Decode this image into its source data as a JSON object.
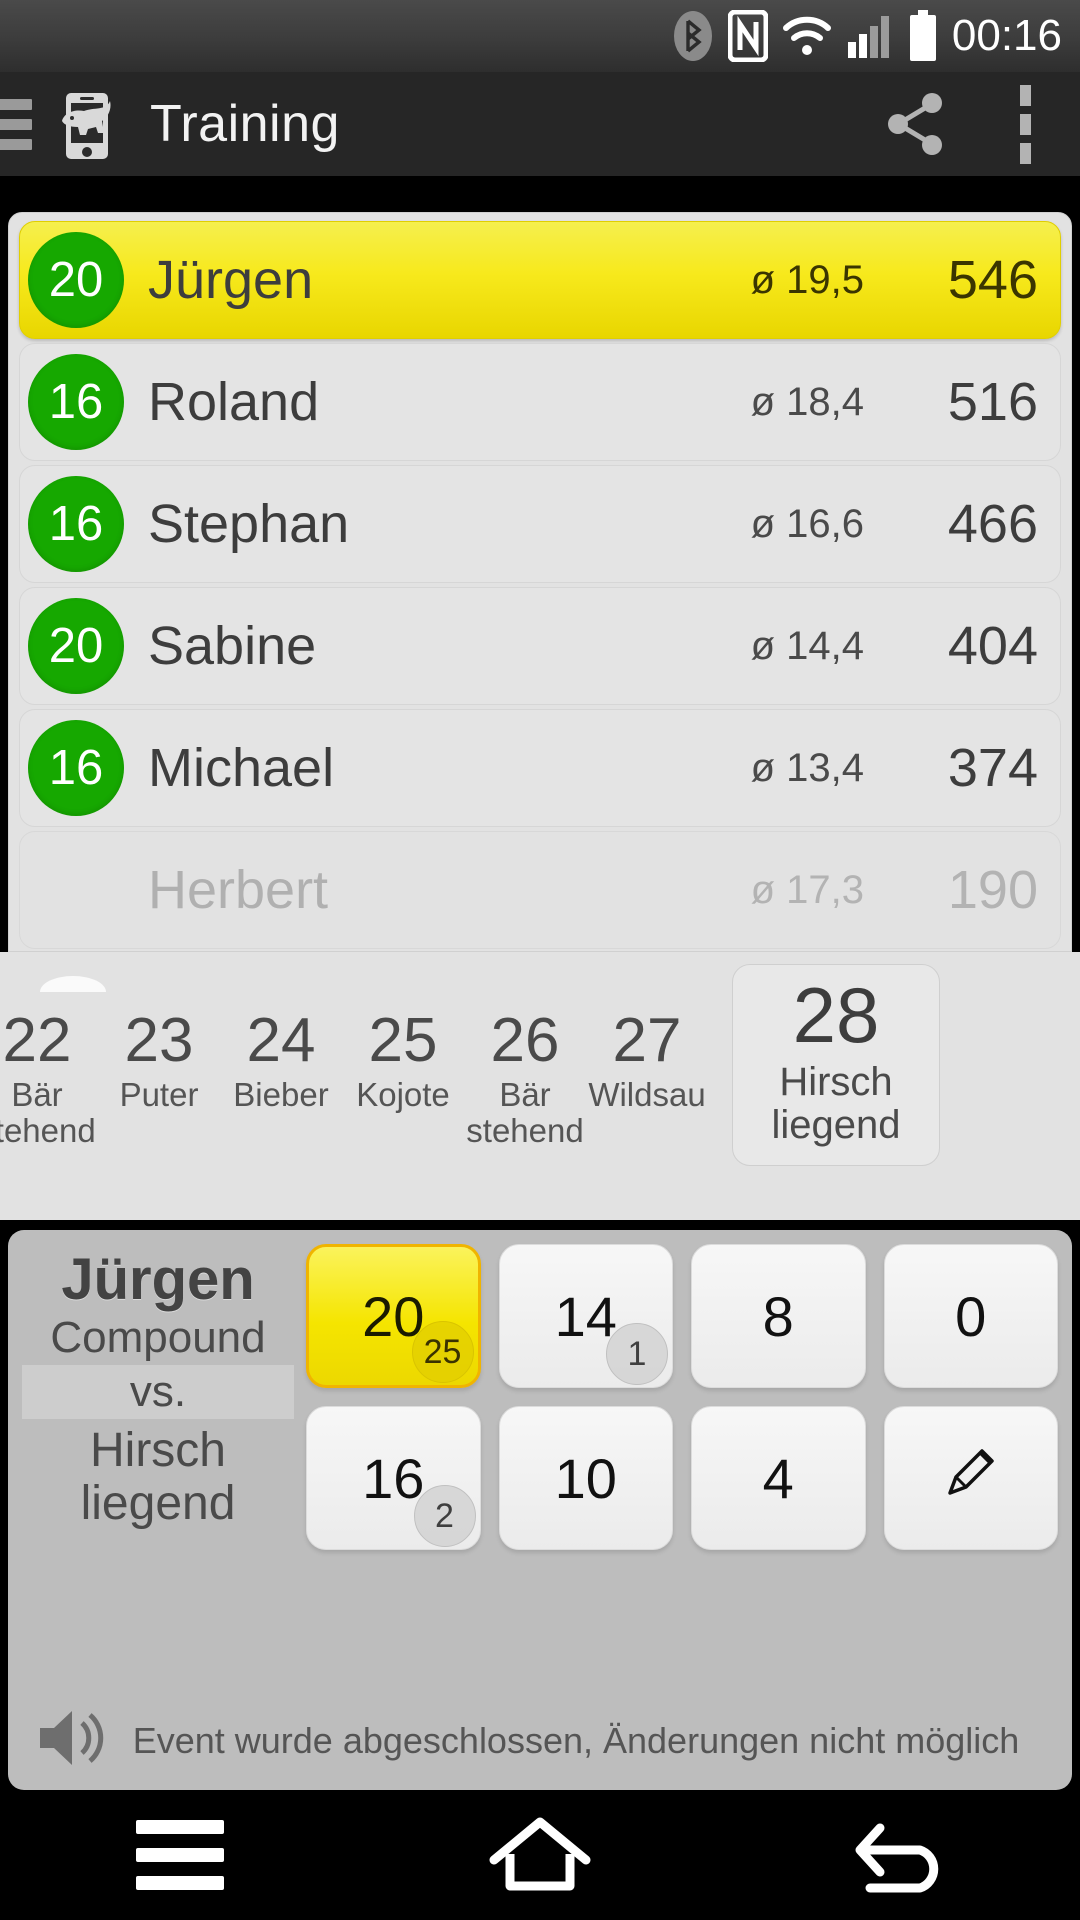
{
  "status_bar": {
    "clock": "00:16",
    "icons": [
      "bluetooth-icon",
      "nfc-icon",
      "wifi-icon",
      "cellular-signal-icon",
      "battery-icon"
    ]
  },
  "app_bar": {
    "title": "Training",
    "drawer_icon": "hamburger-menu-icon",
    "logo_icon": "boar-on-phone-app-icon",
    "share_icon": "share-icon",
    "overflow_icon": "overflow-menu-icon"
  },
  "leaderboard": {
    "rows": [
      {
        "badge": "20",
        "name": "Jürgen",
        "avg": "ø 19,5",
        "total": "546",
        "state": "leader"
      },
      {
        "badge": "16",
        "name": "Roland",
        "avg": "ø 18,4",
        "total": "516",
        "state": "normal"
      },
      {
        "badge": "16",
        "name": "Stephan",
        "avg": "ø 16,6",
        "total": "466",
        "state": "normal"
      },
      {
        "badge": "20",
        "name": "Sabine",
        "avg": "ø 14,4",
        "total": "404",
        "state": "normal"
      },
      {
        "badge": "16",
        "name": "Michael",
        "avg": "ø 13,4",
        "total": "374",
        "state": "normal"
      },
      {
        "badge": "",
        "name": "Herbert",
        "avg": "ø 17,3",
        "total": "190",
        "state": "inactive"
      }
    ]
  },
  "carousel": {
    "items": [
      {
        "number": "22",
        "name": "Bär stehend",
        "selected": false
      },
      {
        "number": "23",
        "name": "Puter",
        "selected": false
      },
      {
        "number": "24",
        "name": "Bieber",
        "selected": false
      },
      {
        "number": "25",
        "name": "Kojote",
        "selected": false
      },
      {
        "number": "26",
        "name": "Bär stehend",
        "selected": false
      },
      {
        "number": "27",
        "name": "Wildsau",
        "selected": false
      },
      {
        "number": "28",
        "name": "Hirsch liegend",
        "selected": true
      }
    ]
  },
  "score_panel": {
    "player": "Jürgen",
    "bow_class": "Compound",
    "vs_label": "vs.",
    "target": "Hirsch liegend",
    "keys": [
      {
        "label": "20",
        "badge": "25",
        "active": true
      },
      {
        "label": "14",
        "badge": "1",
        "active": false
      },
      {
        "label": "8",
        "badge": "",
        "active": false
      },
      {
        "label": "0",
        "badge": "",
        "active": false
      },
      {
        "label": "16",
        "badge": "2",
        "active": false
      },
      {
        "label": "10",
        "badge": "",
        "active": false
      },
      {
        "label": "4",
        "badge": "",
        "active": false
      },
      {
        "label": "",
        "badge": "",
        "active": false,
        "icon": "pencil-edit-icon"
      }
    ],
    "speaker_icon": "speaker-volume-icon",
    "status_message": "Event wurde abgeschlossen, Änderungen nicht möglich"
  },
  "nav_bar": {
    "menu_icon": "menu-icon",
    "home_icon": "home-icon",
    "back_icon": "back-icon"
  },
  "colors": {
    "accent_yellow": "#f5e500",
    "badge_green": "#16a800",
    "appbar_bg": "#262626",
    "panel_bg": "#bdbdbd"
  }
}
